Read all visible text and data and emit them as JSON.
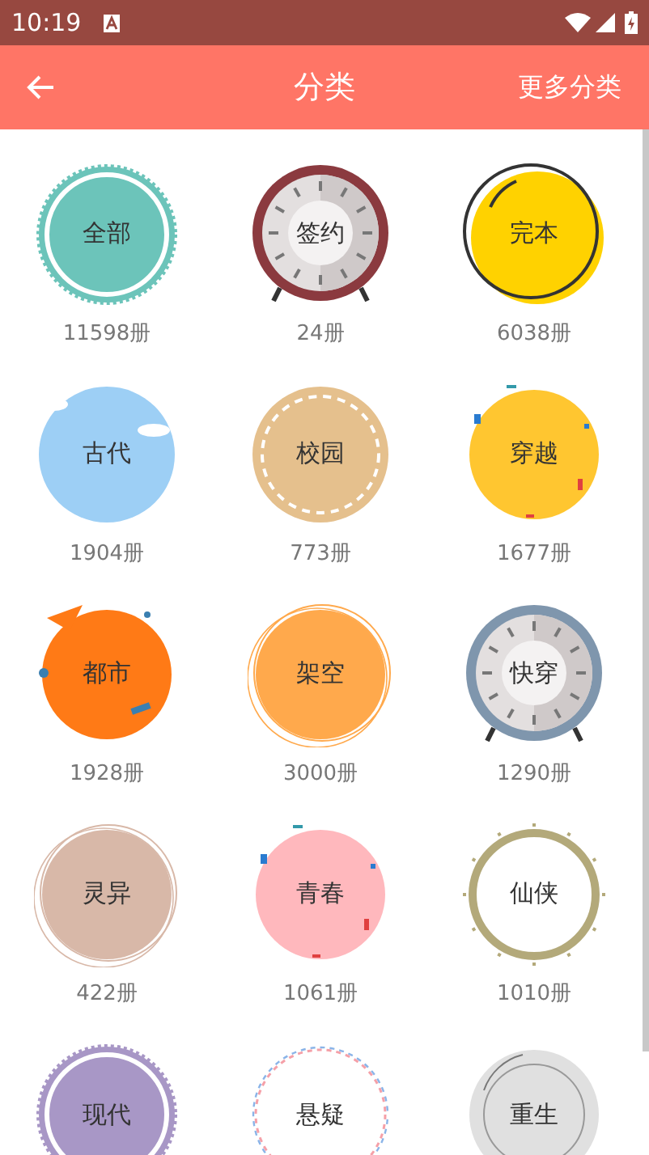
{
  "status_bar": {
    "time": "10:19"
  },
  "app_bar": {
    "title": "分类",
    "action": "更多分类"
  },
  "categories": [
    {
      "name": "全部",
      "count": "11598册",
      "kind": "scalloped",
      "color": "#6cc4ba"
    },
    {
      "name": "签约",
      "count": "24册",
      "kind": "clock",
      "color": "#8b3a3f"
    },
    {
      "name": "完本",
      "count": "6038册",
      "kind": "outline",
      "color": "#ffd200"
    },
    {
      "name": "古代",
      "count": "1904册",
      "kind": "clouds",
      "color": "#9dcff5"
    },
    {
      "name": "校园",
      "count": "773册",
      "kind": "dashed",
      "color": "#e5c08d"
    },
    {
      "name": "穿越",
      "count": "1677册",
      "kind": "confetti",
      "color": "#ffc630"
    },
    {
      "name": "都市",
      "count": "1928册",
      "kind": "splash",
      "color": "#ff7a16"
    },
    {
      "name": "架空",
      "count": "3000册",
      "kind": "sketch",
      "color": "#ffa94c"
    },
    {
      "name": "快穿",
      "count": "1290册",
      "kind": "clock",
      "color": "#7f96ad"
    },
    {
      "name": "灵异",
      "count": "422册",
      "kind": "sketch",
      "color": "#d8b8a8"
    },
    {
      "name": "青春",
      "count": "1061册",
      "kind": "confetti",
      "color": "#ffb8bd"
    },
    {
      "name": "仙侠",
      "count": "1010册",
      "kind": "ring",
      "color": "#b3a97a"
    },
    {
      "name": "现代",
      "kind": "scalloped",
      "color": "#a897c6"
    },
    {
      "name": "悬疑",
      "kind": "wavy",
      "color": "#f5a0a8"
    },
    {
      "name": "重生",
      "kind": "double",
      "color": "#e0e0e0"
    }
  ]
}
